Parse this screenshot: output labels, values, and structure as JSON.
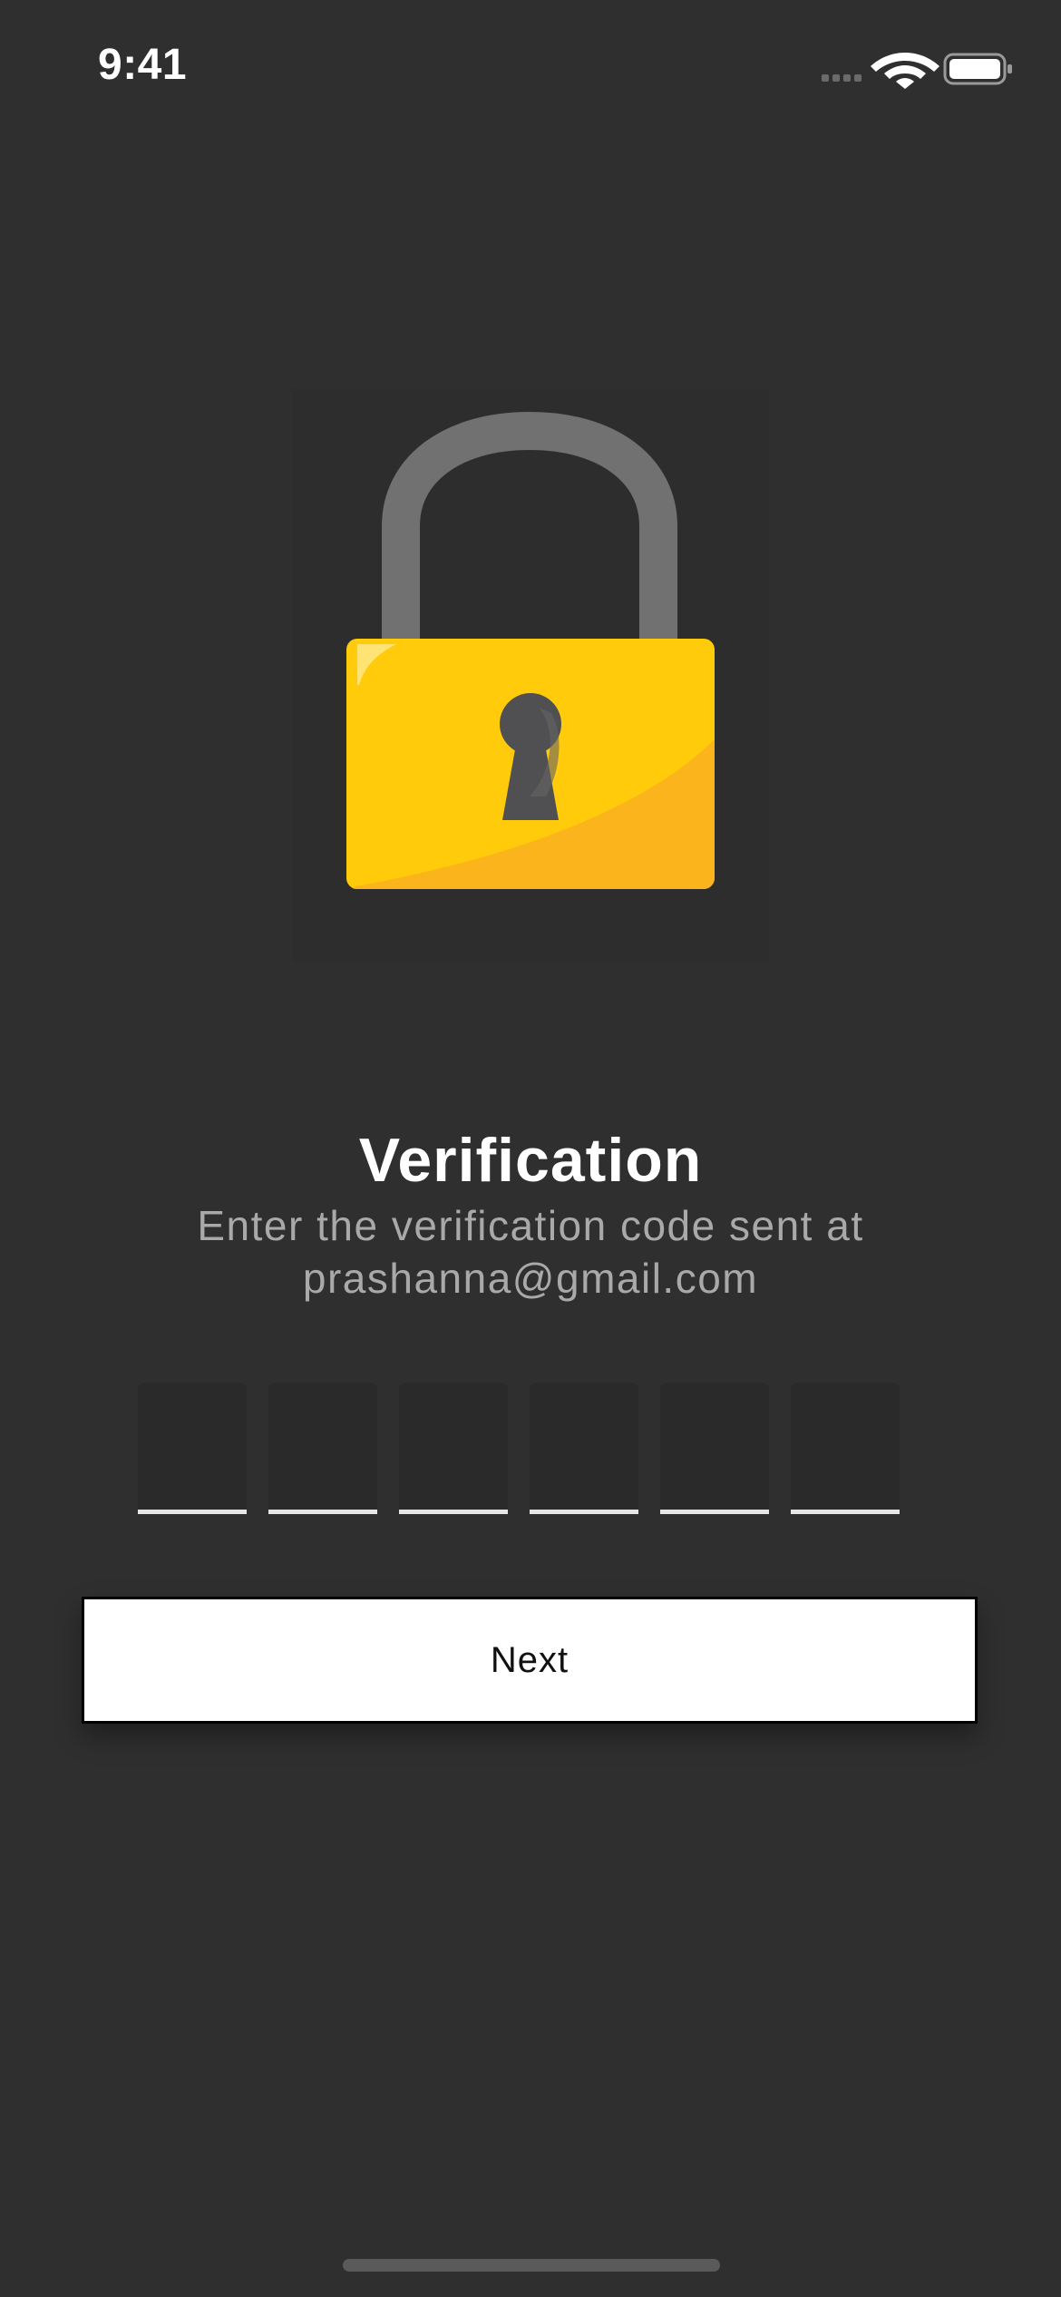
{
  "status_bar": {
    "time": "9:41",
    "icons": [
      "signal-icon",
      "wifi-icon",
      "battery-icon"
    ]
  },
  "illustration": {
    "icon": "padlock-icon",
    "colors": {
      "shackle": "#717171",
      "body": "#ffcb0a",
      "body_shade": "#fbb41c",
      "keyhole": "#505052"
    }
  },
  "verification": {
    "title": "Verification",
    "subtitle_line1": "Enter the verification code sent at",
    "subtitle_line2": "prashanna@gmail.com",
    "code_length": 6,
    "code_digits": [
      "",
      "",
      "",
      "",
      "",
      ""
    ]
  },
  "actions": {
    "next_label": "Next"
  },
  "colors": {
    "background": "#2f2f2f",
    "subtitle": "#a9a9a9",
    "button_bg": "#ffffff",
    "button_text": "#111111",
    "code_underline": "#e6e6e6"
  }
}
